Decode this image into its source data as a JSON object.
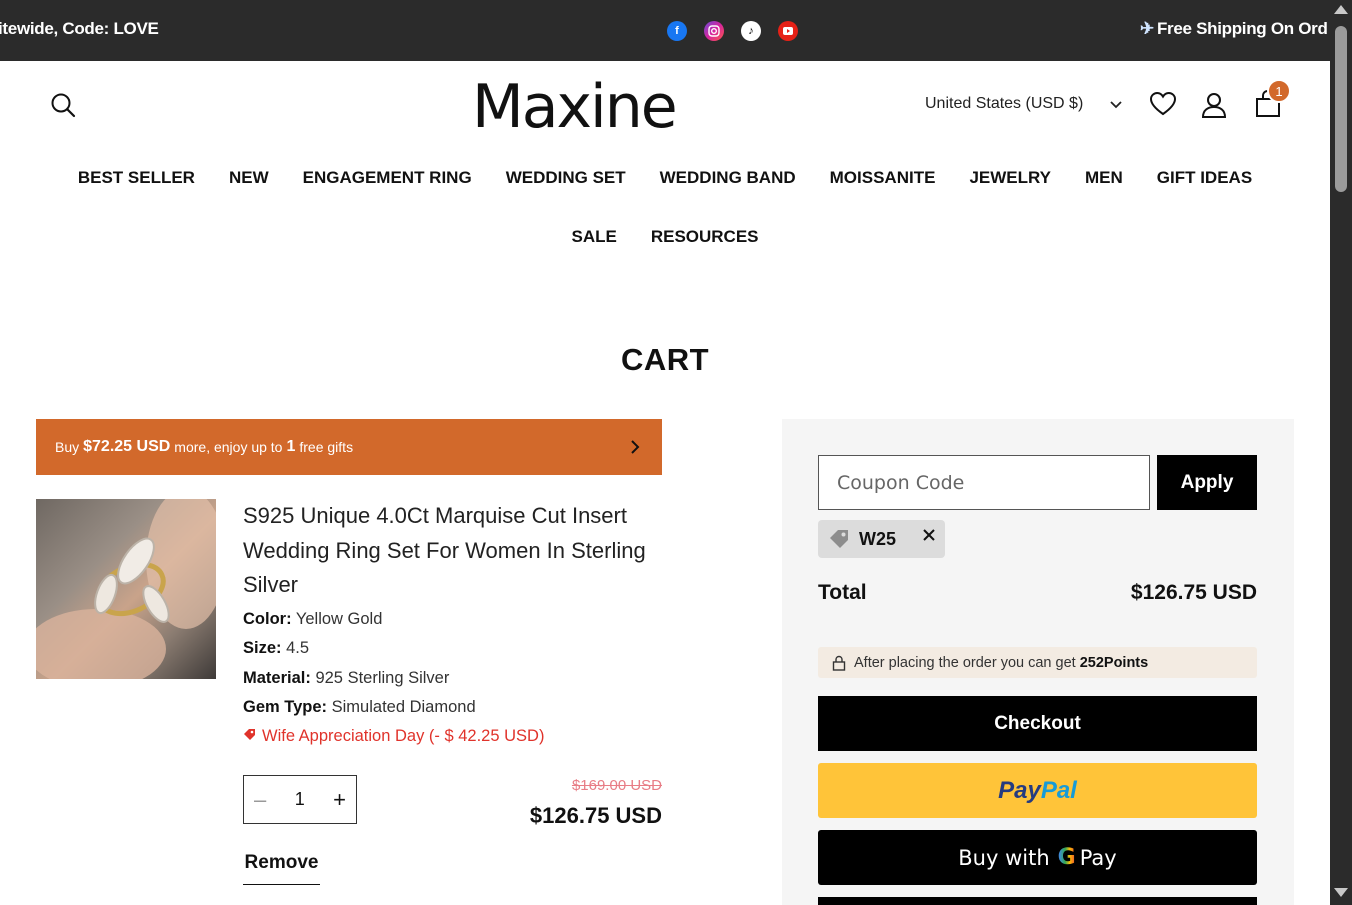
{
  "announcement": {
    "left_text": "itewide, Code: LOVE",
    "right_text": "Free Shipping On Ord",
    "socials": [
      "facebook-icon",
      "instagram-icon",
      "tiktok-icon",
      "youtube-icon"
    ]
  },
  "header": {
    "logo": "Maxine",
    "country": "United States  (USD $)",
    "cart_count": "1"
  },
  "nav": {
    "row1": [
      "BEST SELLER",
      "NEW",
      "ENGAGEMENT RING",
      "WEDDING SET",
      "WEDDING BAND",
      "MOISSANITE",
      "JEWELRY",
      "MEN",
      "GIFT IDEAS"
    ],
    "row2": [
      "SALE",
      "RESOURCES"
    ]
  },
  "page_title": "CART",
  "gift_bar": {
    "prefix": "Buy",
    "amount": "$72.25 USD",
    "middle": "more, enjoy up to",
    "count": "1",
    "suffix": "free gifts"
  },
  "item": {
    "title": "S925 Unique 4.0Ct Marquise Cut Insert Wedding Ring Set For Women In Sterling Silver",
    "attributes": [
      {
        "label": "Color:",
        "value": "Yellow Gold"
      },
      {
        "label": "Size:",
        "value": "4.5"
      },
      {
        "label": "Material:",
        "value": "925 Sterling Silver"
      },
      {
        "label": "Gem Type:",
        "value": "Simulated Diamond"
      }
    ],
    "promotion": "Wife Appreciation Day (- $ 42.25 USD)",
    "quantity": "1",
    "original_price": "$169.00 USD",
    "price": "$126.75 USD",
    "remove_label": "Remove"
  },
  "summary": {
    "coupon_placeholder": "Coupon Code",
    "apply_label": "Apply",
    "applied_code": "W25",
    "total_label": "Total",
    "total_value": "$126.75 USD",
    "points_text": "After placing the order you can get",
    "points_value": "252Points",
    "checkout_label": "Checkout",
    "paypal_a": "Pay",
    "paypal_b": "Pal",
    "gpay_prefix": "Buy with",
    "gpay_g": "G",
    "gpay_suffix": "Pay"
  },
  "colors": {
    "accent": "#d2692b",
    "topbar": "#2b2b2b",
    "promo_red": "#e0332b",
    "paypal_yellow": "#ffc439"
  }
}
